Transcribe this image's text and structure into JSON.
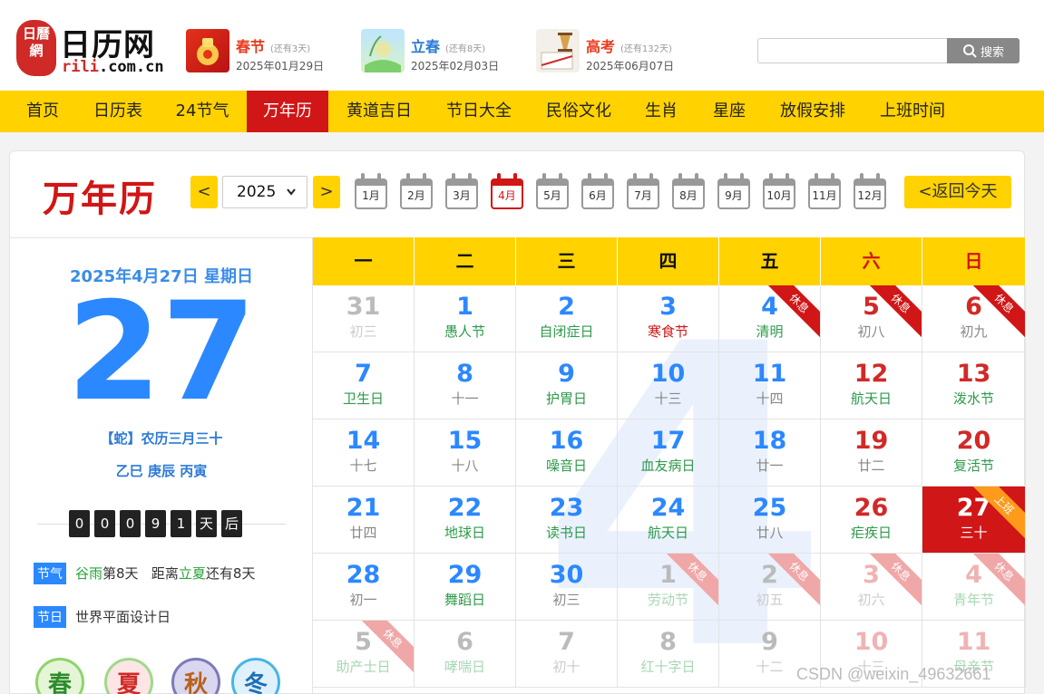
{
  "logo": {
    "mark": "日曆網",
    "title": "日历网",
    "url_r": "rili",
    "url_rest": ".com.cn"
  },
  "festivals": [
    {
      "name": "春节",
      "left": "(还有3天)",
      "date": "2025年01月29日",
      "color": "#e9391c"
    },
    {
      "name": "立春",
      "left": "(还有8天)",
      "date": "2025年02月03日",
      "color": "#2b7bd6"
    },
    {
      "name": "高考",
      "left": "(还有132天)",
      "date": "2025年06月07日",
      "color": "#e9391c"
    }
  ],
  "search": {
    "button": "搜索",
    "placeholder": ""
  },
  "nav": [
    "首页",
    "日历表",
    "24节气",
    "万年历",
    "黄道吉日",
    "节日大全",
    "民俗文化",
    "生肖",
    "星座",
    "放假安排",
    "上班时间"
  ],
  "toolbar": {
    "title": "万年历",
    "prev": "<",
    "next": ">",
    "year": "2025",
    "today": "<返回今天"
  },
  "months": [
    "1月",
    "2月",
    "3月",
    "4月",
    "5月",
    "6月",
    "7月",
    "8月",
    "9月",
    "10月",
    "11月",
    "12月"
  ],
  "info": {
    "date": "2025年4月27日 星期日",
    "day": "27",
    "lunar": "【蛇】农历三月三十",
    "ganzhi": "乙巳 庚辰 丙寅",
    "countdown": [
      "0",
      "0",
      "0",
      "9",
      "1"
    ],
    "countdown_unit": "天",
    "countdown_suffix": "后",
    "solar_tag": "节气",
    "solar_name": "谷雨",
    "solar_days": "第8天",
    "solar_dist": "距离",
    "solar_next": "立夏",
    "solar_remain": "还有8天",
    "holiday_tag": "节日",
    "holiday_text": "世界平面设计日",
    "seasons": [
      "春",
      "夏",
      "秋",
      "冬"
    ]
  },
  "weekdays": [
    "一",
    "二",
    "三",
    "四",
    "五",
    "六",
    "日"
  ],
  "watermark": "4",
  "calendar": [
    [
      {
        "n": "31",
        "s": "初三",
        "other": true
      },
      {
        "n": "1",
        "s": "愚人节",
        "fest": true
      },
      {
        "n": "2",
        "s": "自闭症日",
        "fest": true
      },
      {
        "n": "3",
        "s": "寒食节",
        "red": true
      },
      {
        "n": "4",
        "s": "清明",
        "fest": true,
        "rest": "休息"
      },
      {
        "n": "5",
        "s": "初八",
        "rest": "休息"
      },
      {
        "n": "6",
        "s": "初九",
        "rest": "休息"
      }
    ],
    [
      {
        "n": "7",
        "s": "卫生日",
        "fest": true
      },
      {
        "n": "8",
        "s": "十一"
      },
      {
        "n": "9",
        "s": "护胃日",
        "fest": true
      },
      {
        "n": "10",
        "s": "十三"
      },
      {
        "n": "11",
        "s": "十四"
      },
      {
        "n": "12",
        "s": "航天日",
        "fest": true
      },
      {
        "n": "13",
        "s": "泼水节",
        "fest": true
      }
    ],
    [
      {
        "n": "14",
        "s": "十七"
      },
      {
        "n": "15",
        "s": "十八"
      },
      {
        "n": "16",
        "s": "噪音日",
        "fest": true
      },
      {
        "n": "17",
        "s": "血友病日",
        "fest": true
      },
      {
        "n": "18",
        "s": "廿一"
      },
      {
        "n": "19",
        "s": "廿二"
      },
      {
        "n": "20",
        "s": "复活节",
        "fest": true
      }
    ],
    [
      {
        "n": "21",
        "s": "廿四"
      },
      {
        "n": "22",
        "s": "地球日",
        "fest": true
      },
      {
        "n": "23",
        "s": "读书日",
        "fest": true
      },
      {
        "n": "24",
        "s": "航天日",
        "fest": true
      },
      {
        "n": "25",
        "s": "廿八"
      },
      {
        "n": "26",
        "s": "疟疾日",
        "fest": true
      },
      {
        "n": "27",
        "s": "三十",
        "today": true,
        "rest": "上班",
        "work": true
      }
    ],
    [
      {
        "n": "28",
        "s": "初一"
      },
      {
        "n": "29",
        "s": "舞蹈日",
        "fest": true
      },
      {
        "n": "30",
        "s": "初三"
      },
      {
        "n": "1",
        "s": "劳动节",
        "other": true,
        "fest": true,
        "rest": "休息"
      },
      {
        "n": "2",
        "s": "初五",
        "other": true,
        "rest": "休息"
      },
      {
        "n": "3",
        "s": "初六",
        "other": true,
        "rest": "休息"
      },
      {
        "n": "4",
        "s": "青年节",
        "other": true,
        "fest": true,
        "rest": "休息"
      }
    ],
    [
      {
        "n": "5",
        "s": "助产士日",
        "other": true,
        "fest": true,
        "rest": "休息"
      },
      {
        "n": "6",
        "s": "哮喘日",
        "other": true,
        "fest": true
      },
      {
        "n": "7",
        "s": "初十",
        "other": true
      },
      {
        "n": "8",
        "s": "红十字日",
        "other": true,
        "fest": true
      },
      {
        "n": "9",
        "s": "十二",
        "other": true
      },
      {
        "n": "10",
        "s": "十三",
        "other": true
      },
      {
        "n": "11",
        "s": "母亲节",
        "other": true,
        "fest": true
      }
    ]
  ],
  "csdn": "CSDN @weixin_49632661"
}
